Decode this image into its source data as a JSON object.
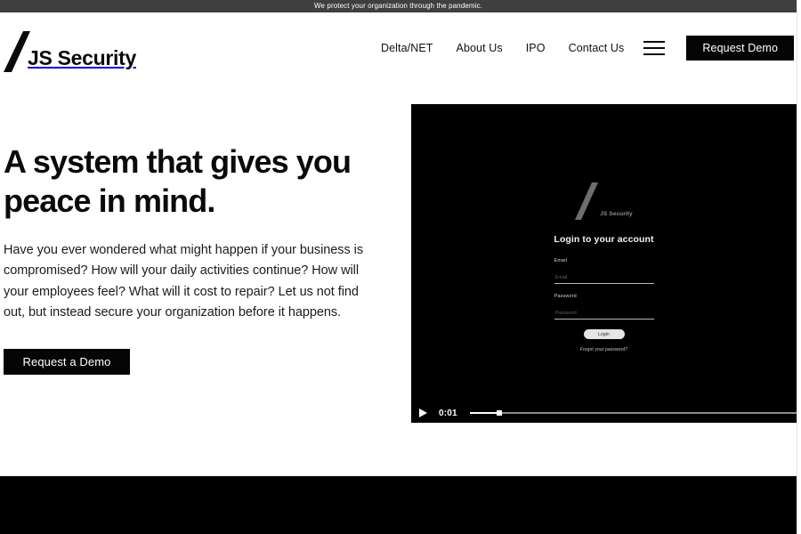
{
  "banner": {
    "text": "We protect your organization through the pandemic."
  },
  "header": {
    "logo": {
      "mark": "slash-logo",
      "name": "JS Security"
    },
    "nav": [
      {
        "label": "Delta/NET"
      },
      {
        "label": "About Us"
      },
      {
        "label": "IPO"
      },
      {
        "label": "Contact Us"
      }
    ],
    "menu_icon": "hamburger-icon",
    "demo_button": "Request Demo"
  },
  "hero": {
    "title": "A system that gives you peace in mind.",
    "body": "Have you ever wondered what might happen if your business is compromised? How will your daily activities continue? How will your employees feel? What will it cost to repair? Let us not find out, but instead secure your organization before it happens.",
    "cta": "Request a Demo"
  },
  "video": {
    "login_screen": {
      "logo_name": "JS Security",
      "heading": "Login to your account",
      "fields": [
        {
          "label": "Email",
          "value": "",
          "placeholder": "Email"
        },
        {
          "label": "Password",
          "value": "",
          "placeholder": "Password"
        }
      ],
      "submit_label": "Login",
      "forgot_link": "Forgot your password?"
    },
    "controls": {
      "play_icon": "play-icon",
      "current_time": "0:01",
      "progress_percent": 9
    }
  },
  "colors": {
    "banner_bg": "#3f3f3f",
    "accent_black": "#050505",
    "page_bg": "#ffffff",
    "video_bg": "#000000"
  }
}
